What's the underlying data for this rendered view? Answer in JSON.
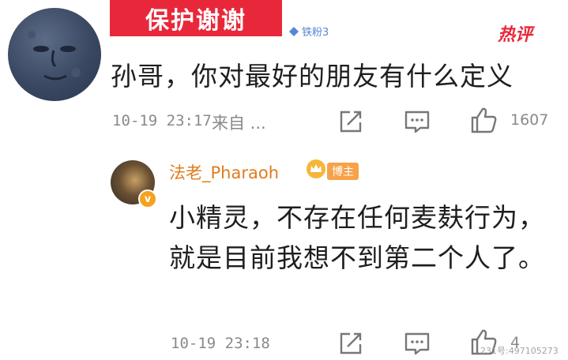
{
  "banner": {
    "text": "保护谢谢"
  },
  "comment": {
    "fan_badge": "铁粉3",
    "hot_label": "热评",
    "text": "孙哥，你对最好的朋友有什么定义",
    "time": "10-19 23:17",
    "source": "来自 ...",
    "likes": "1607"
  },
  "reply": {
    "author": "法老_Pharaoh",
    "badge": "博主",
    "text": "小精灵，不存在任何麦麸行为，就是目前我想不到第二个人了。",
    "time": "10-19 23:18",
    "likes": "4",
    "watermark": "231号:497105273"
  },
  "colors": {
    "banner": "#e8283a",
    "hot": "#e8283a",
    "author": "#e07b1d",
    "badge": "#f7a24a",
    "meta": "#8a8a8a"
  },
  "icons": [
    "moon-face-avatar",
    "diamond-icon",
    "share-icon",
    "comment-icon",
    "like-icon",
    "crown-icon",
    "verified-icon"
  ]
}
